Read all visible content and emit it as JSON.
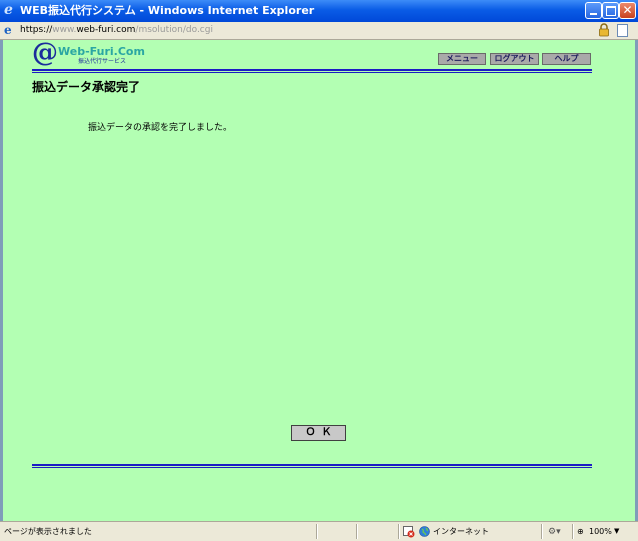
{
  "window": {
    "title": "WEB振込代行システム - Windows Internet Explorer",
    "icon": "ie-icon",
    "controls": [
      "minimize-icon",
      "maximize-icon",
      "close-icon"
    ]
  },
  "address_bar": {
    "scheme": "https://",
    "host_prefix": "www.",
    "host": "web-furi.com",
    "path": "/msolution/do.cgi"
  },
  "header": {
    "logo_at": "@",
    "logo_main": "Web-Furi.Com",
    "logo_sub": "振込代行サービス",
    "nav": {
      "menu_label": "メニュー",
      "logout_label": "ログアウト",
      "help_label": "ヘルプ"
    }
  },
  "main": {
    "page_title": "振込データ承認完了",
    "message": "振込データの承認を完了しました。",
    "ok_label": "ＯＫ"
  },
  "status_bar": {
    "status_text": "ページが表示されました",
    "zone_text": "インターネット",
    "zoom_label": "100%"
  },
  "colors": {
    "page_background": "#b3ffb3",
    "rule_color": "#1c1cc4",
    "titlebar_blue": "#0a5ce6"
  }
}
